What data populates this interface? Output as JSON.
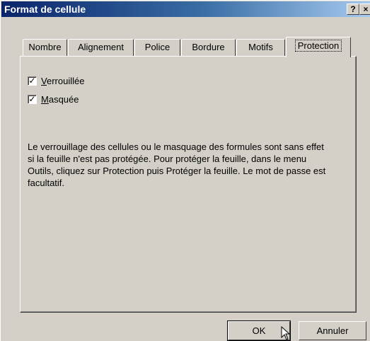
{
  "window": {
    "title": "Format de cellule",
    "help_glyph": "?",
    "close_glyph": "×"
  },
  "tabs": [
    {
      "label": "Nombre",
      "active": false
    },
    {
      "label": "Alignement",
      "active": false
    },
    {
      "label": "Police",
      "active": false
    },
    {
      "label": "Bordure",
      "active": false
    },
    {
      "label": "Motifs",
      "active": false
    },
    {
      "label": "Protection",
      "active": true
    }
  ],
  "protection": {
    "locked": {
      "label_underlined": "V",
      "label_rest": "errouillée",
      "checked": true
    },
    "hidden": {
      "label_underlined": "M",
      "label_rest": "asquée",
      "checked": true
    },
    "info_text": "Le verrouillage des cellules ou le masquage des formules sont sans effet si la feuille n'est pas protégée. Pour protéger la feuille, dans le menu Outils, cliquez sur Protection puis Protéger la feuille. Le mot de passe est facultatif."
  },
  "buttons": {
    "ok": "OK",
    "cancel": "Annuler"
  },
  "colors": {
    "face": "#d4d0c8",
    "title_start": "#0a246a",
    "title_end": "#a6caf0"
  },
  "icons": {
    "check": "check-icon",
    "cursor": "mouse-pointer-icon"
  }
}
